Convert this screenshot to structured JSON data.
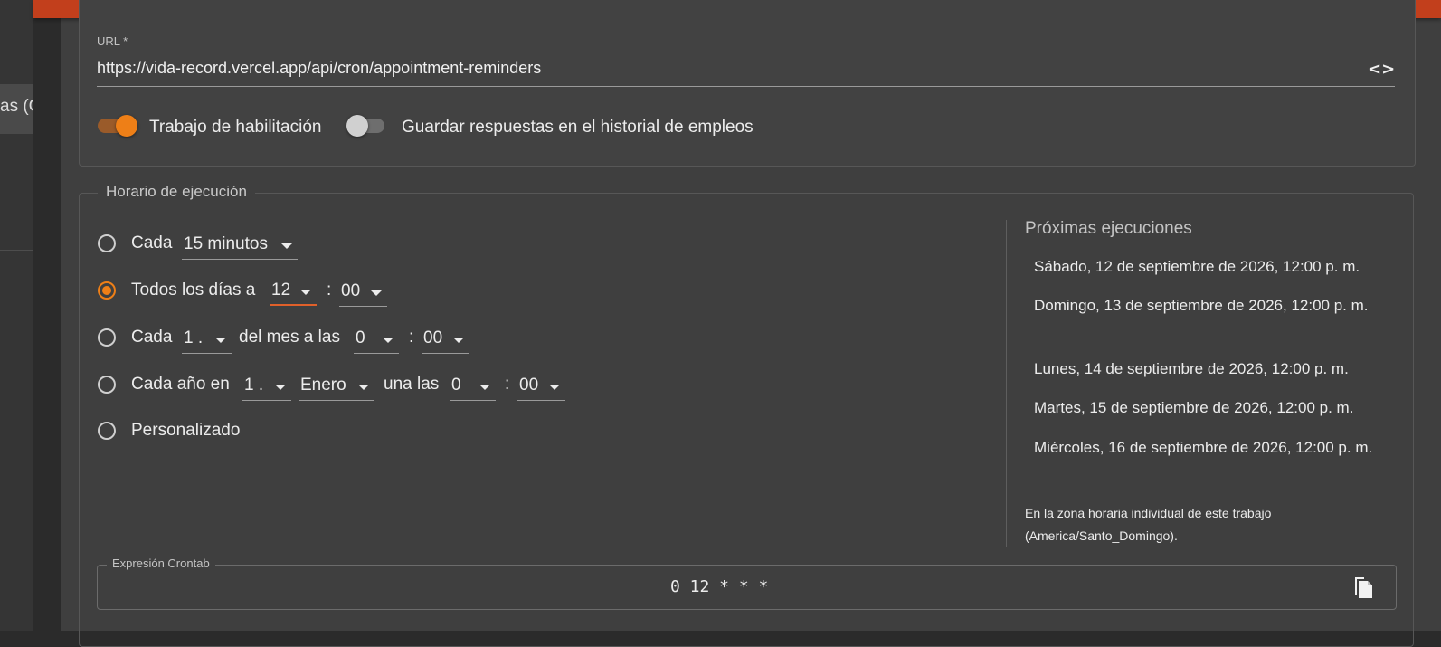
{
  "sidebar": {
    "item_label": "as (C"
  },
  "job": {
    "url_label": "URL *",
    "url_value": "https://vida-record.vercel.app/api/cron/appointment-reminders",
    "enable_label": "Trabajo de habilitación",
    "enable_on": true,
    "save_responses_label": "Guardar respuestas en el historial de empleos",
    "save_responses_on": false
  },
  "schedule": {
    "legend": "Horario de ejecución",
    "selected_option": "daily",
    "every": {
      "label": "Cada",
      "value": "15 minutos"
    },
    "daily": {
      "label": "Todos los días a",
      "hour": "12",
      "sep": ":",
      "minute": "00"
    },
    "monthly": {
      "label": "Cada",
      "day": "1 .",
      "middle": "del mes a las",
      "hour": "0",
      "sep": ":",
      "minute": "00"
    },
    "yearly": {
      "label": "Cada año en",
      "day": "1 .",
      "month": "Enero",
      "middle": "una las",
      "hour": "0",
      "sep": ":",
      "minute": "00"
    },
    "custom": {
      "label": "Personalizado"
    }
  },
  "next_runs": {
    "title": "Próximas ejecuciones",
    "items": [
      "Sábado, 12 de septiembre de 2026, 12:00 p. m.",
      "Domingo, 13 de septiembre de 2026, 12:00 p. m.",
      "Lunes, 14 de septiembre de 2026, 12:00 p. m.",
      "Martes, 15 de septiembre de 2026, 12:00 p. m.",
      "Miércoles, 16 de septiembre de 2026, 12:00 p. m."
    ],
    "timezone_note": "En la zona horaria individual de este trabajo (America/Santo_Domingo)."
  },
  "crontab": {
    "label": "Expresión Crontab",
    "value": "0 12 * * *"
  },
  "icons": {
    "code": "code-icon",
    "copy": "copy-icon"
  },
  "colors": {
    "accent": "#ee7f17",
    "topbar": "#c23f1c"
  }
}
